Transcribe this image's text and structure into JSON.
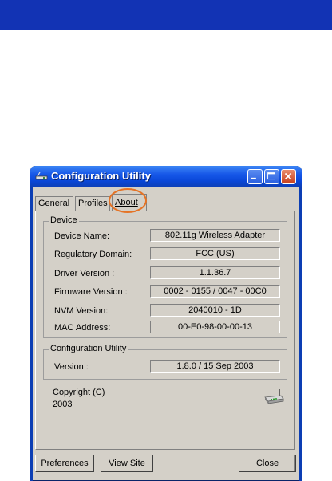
{
  "window": {
    "title": "Configuration Utility"
  },
  "tabs": [
    {
      "label": "General"
    },
    {
      "label": "Profiles"
    },
    {
      "label": "About"
    }
  ],
  "device": {
    "legend": "Device",
    "rows": [
      {
        "label": "Device Name:",
        "value": "802.11g Wireless Adapter"
      },
      {
        "label": "Regulatory Domain:",
        "value": "FCC (US)"
      },
      {
        "label": "Driver Version :",
        "value": "1.1.36.7"
      },
      {
        "label": "Firmware Version :",
        "value": "0002 - 0155 / 0047 - 00C0"
      },
      {
        "label": "NVM Version:",
        "value": "2040010 - 1D"
      },
      {
        "label": "MAC Address:",
        "value": "00-E0-98-00-00-13"
      }
    ]
  },
  "config_utility": {
    "legend": "Configuration Utility",
    "version_label": "Version :",
    "version_value": "1.8.0 / 15 Sep 2003"
  },
  "copyright": {
    "line1": "Copyright (C)",
    "line2": "2003"
  },
  "buttons": {
    "preferences": "Preferences",
    "view_site": "View Site",
    "close": "Close"
  },
  "colors": {
    "title_bar": "#0c3eb4",
    "top_band": "#1233b4",
    "highlight_ring": "#e57325",
    "dialog_bg": "#d4d0c8"
  },
  "icons": {
    "app": "wireless-card-icon",
    "network": "wireless-router-icon"
  }
}
